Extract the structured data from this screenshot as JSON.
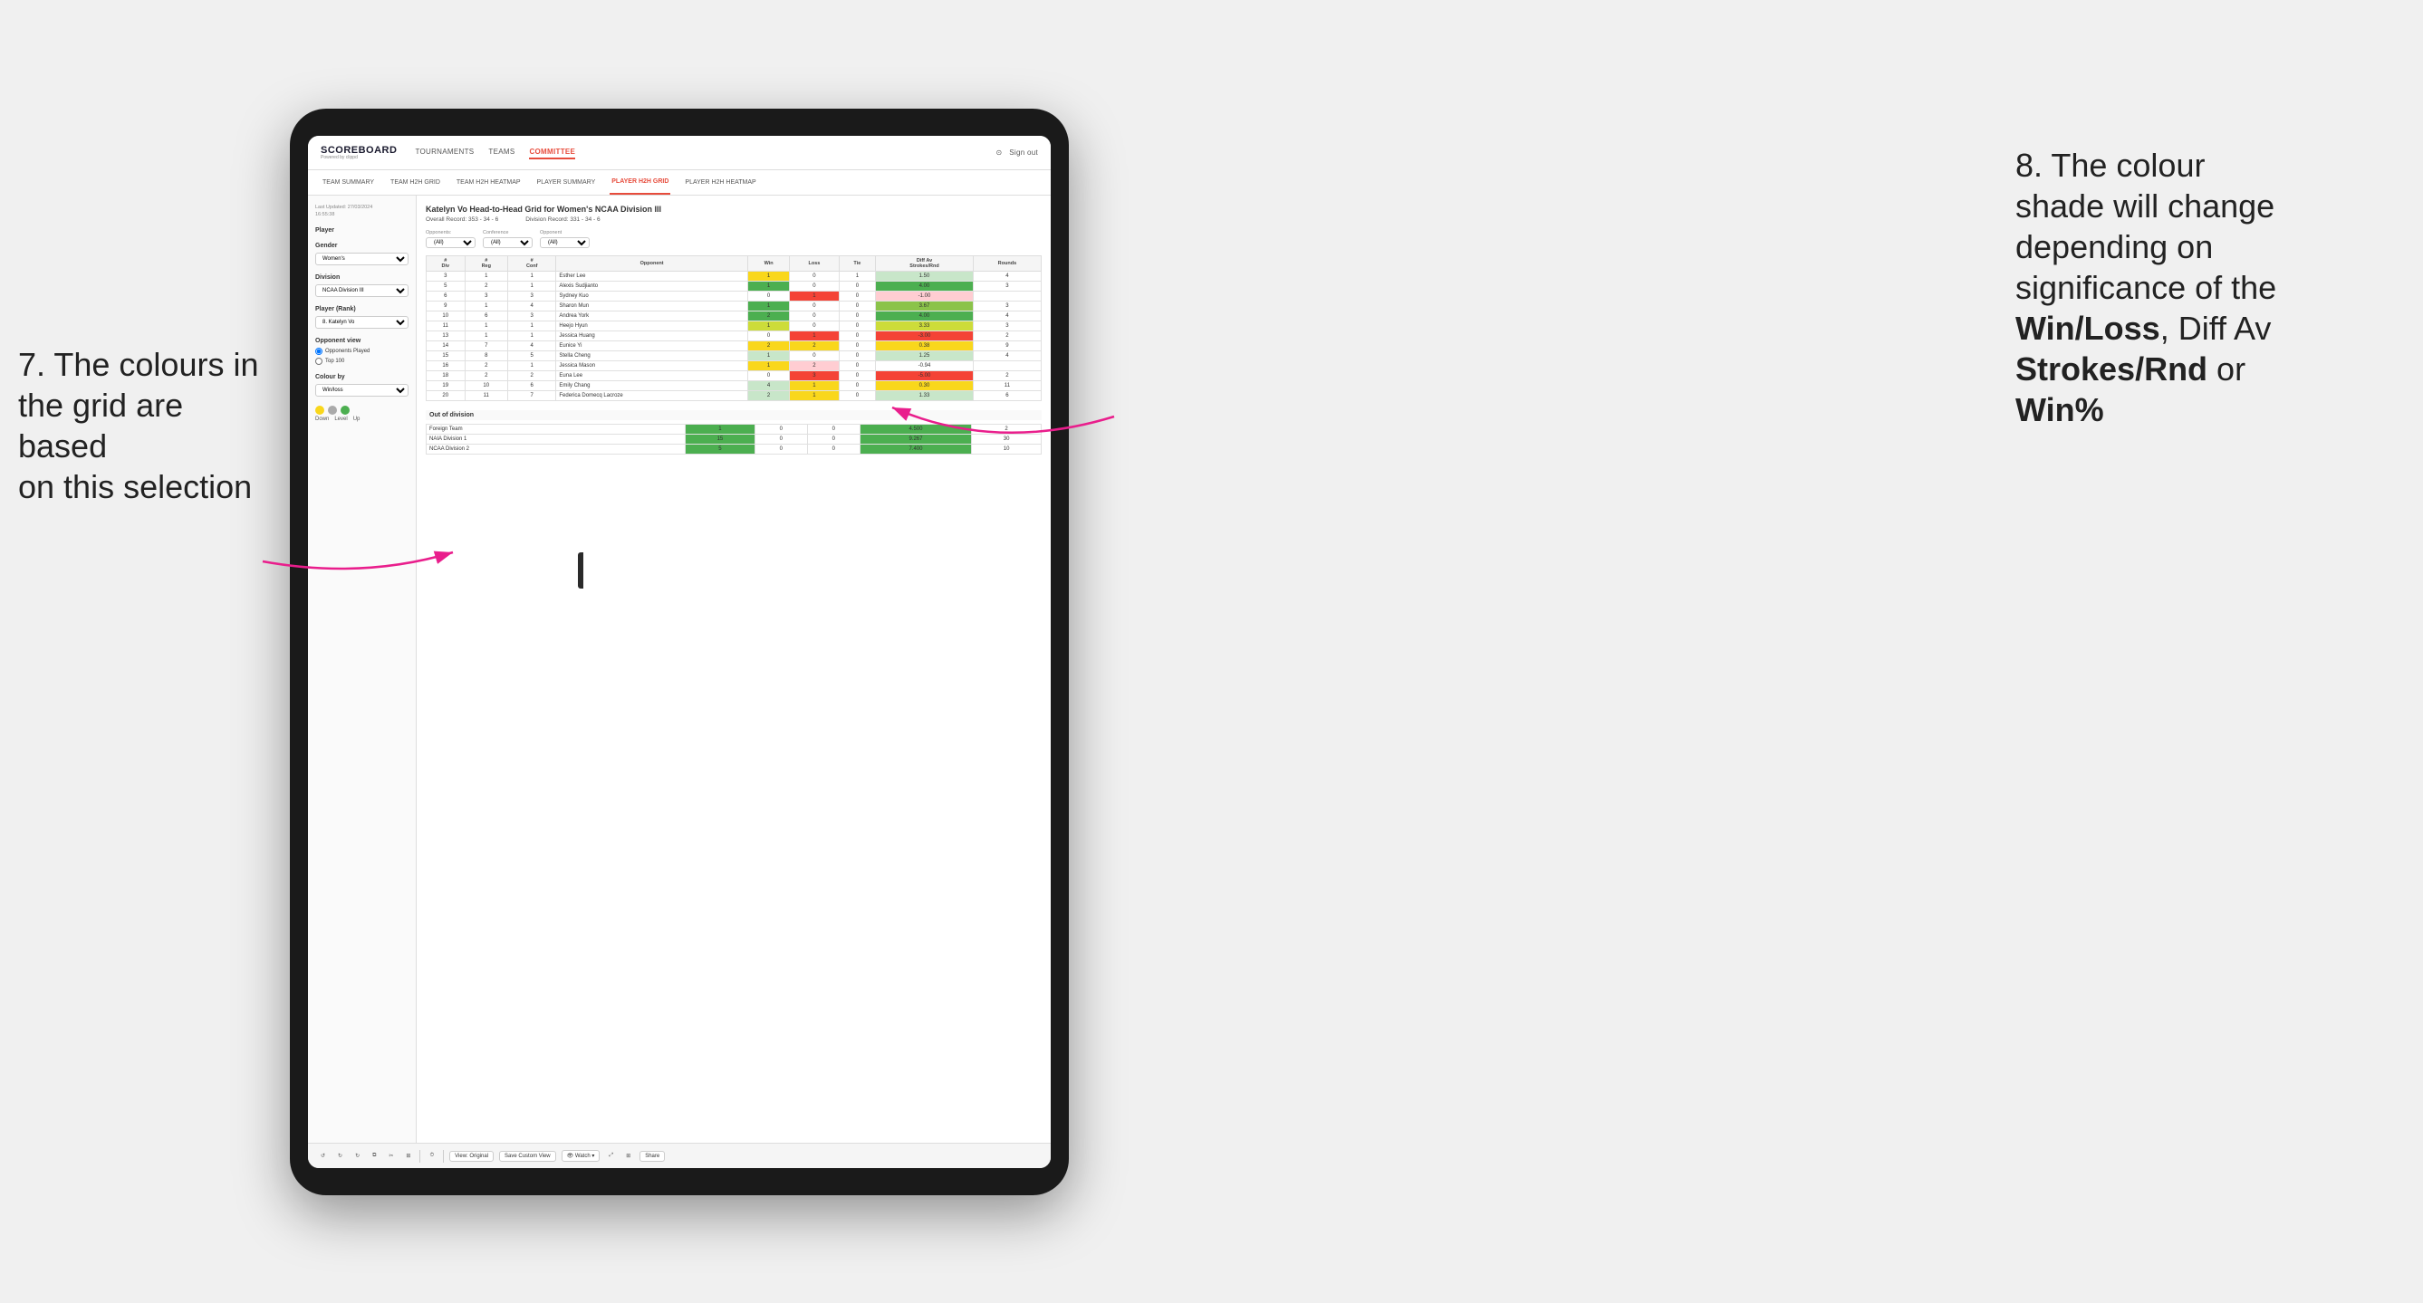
{
  "annotations": {
    "left": {
      "line1": "7. The colours in",
      "line2": "the grid are based",
      "line3": "on this selection"
    },
    "right": {
      "line1": "8. The colour",
      "line2": "shade will change",
      "line3": "depending on",
      "line4": "significance of the",
      "line5_bold": "Win/Loss",
      "line5_rest": ", Diff Av",
      "line6_bold": "Strokes/Rnd",
      "line6_rest": " or",
      "line7_bold": "Win%"
    }
  },
  "nav": {
    "logo": "SCOREBOARD",
    "logo_sub": "Powered by clippd",
    "items": [
      "TOURNAMENTS",
      "TEAMS",
      "COMMITTEE"
    ],
    "active": "COMMITTEE",
    "sign_out": "Sign out"
  },
  "sub_nav": {
    "items": [
      "TEAM SUMMARY",
      "TEAM H2H GRID",
      "TEAM H2H HEATMAP",
      "PLAYER SUMMARY",
      "PLAYER H2H GRID",
      "PLAYER H2H HEATMAP"
    ],
    "active": "PLAYER H2H GRID"
  },
  "sidebar": {
    "timestamp": "Last Updated: 27/03/2024\n16:55:38",
    "player_section": "Player",
    "gender_label": "Gender",
    "gender_value": "Women's",
    "division_label": "Division",
    "division_value": "NCAA Division III",
    "player_rank_label": "Player (Rank)",
    "player_rank_value": "8. Katelyn Vo",
    "opponent_view_label": "Opponent view",
    "opponent_played": "Opponents Played",
    "top_100": "Top 100",
    "colour_by_label": "Colour by",
    "colour_by_value": "Win/loss",
    "legend": {
      "down": "Down",
      "level": "Level",
      "up": "Up"
    }
  },
  "grid": {
    "title": "Katelyn Vo Head-to-Head Grid for Women's NCAA Division III",
    "overall_record": "Overall Record: 353 - 34 - 6",
    "division_record": "Division Record: 331 - 34 - 6",
    "filter_opponents_label": "Opponents:",
    "filter_opponents_value": "(All)",
    "filter_conference_label": "Conference",
    "filter_conference_value": "(All)",
    "filter_opponent_label": "Opponent",
    "filter_opponent_value": "(All)",
    "headers": [
      "#\nDiv",
      "#\nReg",
      "#\nConf",
      "Opponent",
      "Win",
      "Loss",
      "Tie",
      "Diff Av\nStrokes/Rnd",
      "Rounds"
    ],
    "rows": [
      {
        "div": 3,
        "reg": 1,
        "conf": 1,
        "opponent": "Esther Lee",
        "win": 1,
        "loss": 0,
        "tie": 1,
        "diff": 1.5,
        "rounds": 4,
        "win_color": "yellow",
        "loss_color": "",
        "diff_color": "green_light"
      },
      {
        "div": 5,
        "reg": 2,
        "conf": 1,
        "opponent": "Alexis Sudjianto",
        "win": 1,
        "loss": 0,
        "tie": 0,
        "diff": 4.0,
        "rounds": 3,
        "win_color": "green",
        "loss_color": "",
        "diff_color": "green"
      },
      {
        "div": 6,
        "reg": 3,
        "conf": 3,
        "opponent": "Sydney Kuo",
        "win": 0,
        "loss": 1,
        "tie": 0,
        "diff": -1.0,
        "rounds": "",
        "win_color": "",
        "loss_color": "red_strong",
        "diff_color": "red_light"
      },
      {
        "div": 9,
        "reg": 1,
        "conf": 4,
        "opponent": "Sharon Mun",
        "win": 1,
        "loss": 0,
        "tie": 0,
        "diff": 3.67,
        "rounds": 3,
        "win_color": "green",
        "loss_color": "",
        "diff_color": "green"
      },
      {
        "div": 10,
        "reg": 6,
        "conf": 3,
        "opponent": "Andrea York",
        "win": 2,
        "loss": 0,
        "tie": 0,
        "diff": 4.0,
        "rounds": 4,
        "win_color": "green",
        "loss_color": "",
        "diff_color": "green"
      },
      {
        "div": 11,
        "reg": 1,
        "conf": 1,
        "opponent": "Heejo Hyun",
        "win": 1,
        "loss": 0,
        "tie": 0,
        "diff": 3.33,
        "rounds": 3,
        "win_color": "green_light",
        "loss_color": "",
        "diff_color": "green_light"
      },
      {
        "div": 13,
        "reg": 1,
        "conf": 1,
        "opponent": "Jessica Huang",
        "win": 0,
        "loss": 1,
        "tie": 0,
        "diff": -3.0,
        "rounds": 2,
        "win_color": "",
        "loss_color": "red_strong",
        "diff_color": "red_strong"
      },
      {
        "div": 14,
        "reg": 7,
        "conf": 4,
        "opponent": "Eunice Yi",
        "win": 2,
        "loss": 2,
        "tie": 0,
        "diff": 0.38,
        "rounds": 9,
        "win_color": "yellow",
        "loss_color": "yellow",
        "diff_color": "yellow"
      },
      {
        "div": 15,
        "reg": 8,
        "conf": 5,
        "opponent": "Stella Cheng",
        "win": 1,
        "loss": 0,
        "tie": 0,
        "diff": 1.25,
        "rounds": 4,
        "win_color": "green_light",
        "loss_color": "",
        "diff_color": "green_light"
      },
      {
        "div": 16,
        "reg": 2,
        "conf": 1,
        "opponent": "Jessica Mason",
        "win": 1,
        "loss": 2,
        "tie": 0,
        "diff": -0.94,
        "rounds": "",
        "win_color": "yellow",
        "loss_color": "red_light",
        "diff_color": ""
      },
      {
        "div": 18,
        "reg": 2,
        "conf": 2,
        "opponent": "Euna Lee",
        "win": 0,
        "loss": 3,
        "tie": 0,
        "diff": -5.0,
        "rounds": 2,
        "win_color": "",
        "loss_color": "red_strong",
        "diff_color": "red_strong"
      },
      {
        "div": 19,
        "reg": 10,
        "conf": 6,
        "opponent": "Emily Chang",
        "win": 4,
        "loss": 1,
        "tie": 0,
        "diff": 0.3,
        "rounds": 11,
        "win_color": "green_light",
        "loss_color": "yellow",
        "diff_color": "yellow"
      },
      {
        "div": 20,
        "reg": 11,
        "conf": 7,
        "opponent": "Federica Domecq Lacroze",
        "win": 2,
        "loss": 1,
        "tie": 0,
        "diff": 1.33,
        "rounds": 6,
        "win_color": "green_light",
        "loss_color": "yellow",
        "diff_color": "green_light"
      }
    ],
    "out_of_division": "Out of division",
    "out_rows": [
      {
        "label": "Foreign Team",
        "win": 1,
        "loss": 0,
        "tie": 0,
        "diff": 4.5,
        "rounds": 2,
        "win_color": "green",
        "loss_color": ""
      },
      {
        "label": "NAIA Division 1",
        "win": 15,
        "loss": 0,
        "tie": 0,
        "diff": 9.267,
        "rounds": 30,
        "win_color": "green",
        "loss_color": ""
      },
      {
        "label": "NCAA Division 2",
        "win": 5,
        "loss": 0,
        "tie": 0,
        "diff": 7.4,
        "rounds": 10,
        "win_color": "green",
        "loss_color": ""
      }
    ]
  },
  "toolbar": {
    "view_original": "View: Original",
    "save_custom": "Save Custom View",
    "watch": "Watch",
    "share": "Share"
  }
}
